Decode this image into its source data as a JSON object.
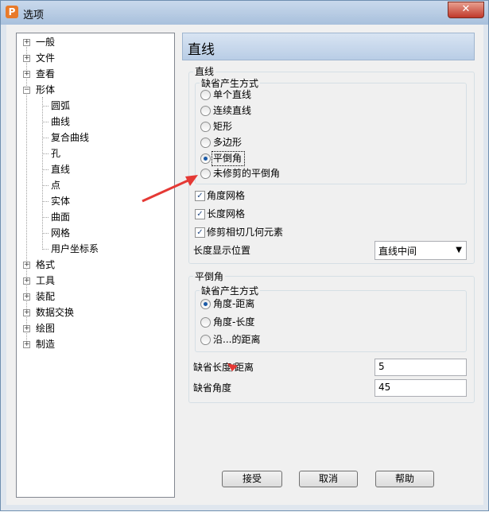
{
  "window": {
    "title": "选项",
    "app_icon": "P",
    "close_glyph": "✕"
  },
  "tree": {
    "items": [
      "一般",
      "文件",
      "查看",
      "形体",
      "圆弧",
      "曲线",
      "复合曲线",
      "孔",
      "直线",
      "点",
      "实体",
      "曲面",
      "网格",
      "用户坐标系",
      "格式",
      "工具",
      "装配",
      "数据交换",
      "绘图",
      "制造"
    ],
    "expanders": {
      "collapsed": "+",
      "expanded": "−"
    }
  },
  "panel": {
    "header": "直线",
    "line_group": {
      "title": "直线",
      "default_method": {
        "title": "缺省产生方式",
        "options": [
          "单个直线",
          "连续直线",
          "矩形",
          "多边形",
          "平倒角",
          "未修剪的平倒角"
        ],
        "selected": "平倒角"
      },
      "checkboxes": [
        {
          "label": "角度网格",
          "checked": true
        },
        {
          "label": "长度网格",
          "checked": true
        },
        {
          "label": "修剪相切几何元素",
          "checked": true
        }
      ],
      "length_display": {
        "label": "长度显示位置",
        "value": "直线中间"
      }
    },
    "chamfer_group": {
      "title": "平倒角",
      "default_method": {
        "title": "缺省产生方式",
        "options": [
          "角度-距离",
          "角度-长度",
          "沿...的距离"
        ],
        "selected": "角度-距离"
      },
      "default_length": {
        "label": "缺省长度/距离",
        "value": "5"
      },
      "default_angle": {
        "label": "缺省角度",
        "value": "45"
      }
    }
  },
  "buttons": {
    "ok": "接受",
    "cancel": "取消",
    "help": "帮助"
  },
  "annotation": {
    "arrow_color": "#e53935"
  }
}
